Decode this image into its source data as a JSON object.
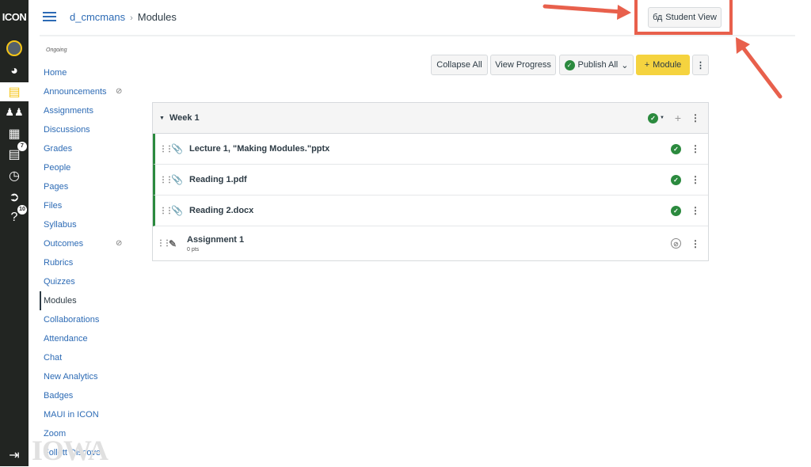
{
  "rail": {
    "logo": "ICON",
    "items": [
      {
        "icon": "account-avatar"
      },
      {
        "icon": "dashboard-icon"
      },
      {
        "icon": "courses-icon",
        "active": true
      },
      {
        "icon": "groups-icon"
      },
      {
        "icon": "calendar-icon"
      },
      {
        "icon": "inbox-icon",
        "badge": "7"
      },
      {
        "icon": "history-icon"
      },
      {
        "icon": "commons-icon"
      },
      {
        "icon": "help-icon",
        "badge": "10"
      }
    ],
    "collapse_icon": "collapse-icon"
  },
  "header": {
    "course": "d_cmcmans",
    "page": "Modules",
    "student_view": "Student View"
  },
  "nav": {
    "term": "Ongoing",
    "items": [
      {
        "label": "Home"
      },
      {
        "label": "Announcements",
        "hidden": true
      },
      {
        "label": "Assignments"
      },
      {
        "label": "Discussions"
      },
      {
        "label": "Grades"
      },
      {
        "label": "People"
      },
      {
        "label": "Pages"
      },
      {
        "label": "Files"
      },
      {
        "label": "Syllabus"
      },
      {
        "label": "Outcomes",
        "hidden": true
      },
      {
        "label": "Rubrics"
      },
      {
        "label": "Quizzes"
      },
      {
        "label": "Modules",
        "active": true
      },
      {
        "label": "Collaborations"
      },
      {
        "label": "Attendance"
      },
      {
        "label": "Chat"
      },
      {
        "label": "New Analytics"
      },
      {
        "label": "Badges"
      },
      {
        "label": "MAUI in ICON"
      },
      {
        "label": "Zoom"
      },
      {
        "label": "Follett Discover"
      }
    ]
  },
  "toolbar": {
    "collapse_all": "Collapse All",
    "view_progress": "View Progress",
    "publish_all": "Publish All",
    "add_module": "Module"
  },
  "module": {
    "title": "Week 1",
    "items": [
      {
        "title": "Lecture 1, \"Making Modules.\"pptx",
        "type": "attachment",
        "published": true
      },
      {
        "title": "Reading 1.pdf",
        "type": "attachment",
        "published": true
      },
      {
        "title": "Reading 2.docx",
        "type": "attachment",
        "published": true
      },
      {
        "title": "Assignment 1",
        "sub": "0 pts",
        "type": "assignment",
        "published": false
      }
    ]
  },
  "watermark": "IOWA",
  "colors": {
    "rail": "#222522",
    "link": "#2d6bb5",
    "published": "#2b8a3e",
    "add_button": "#f5d33f",
    "annotation": "#e8604c"
  }
}
